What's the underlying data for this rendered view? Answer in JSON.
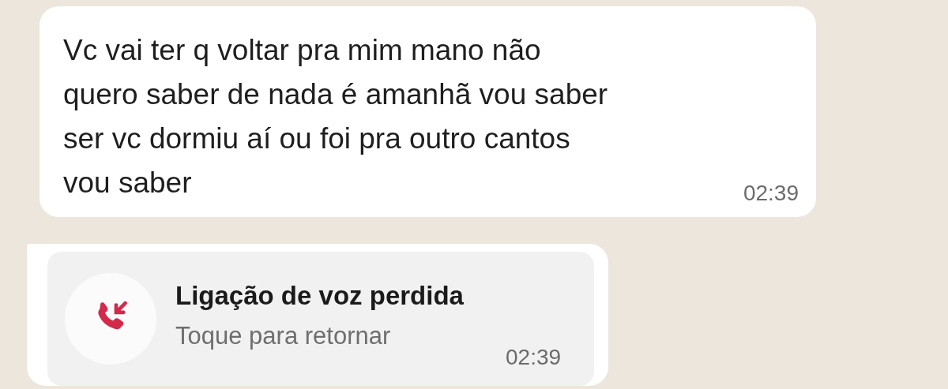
{
  "messages": [
    {
      "kind": "text",
      "text": "Vc vai ter q voltar pra mim mano não\nquero saber de nada é amanhã vou saber\nser vc dormiu aí ou foi pra outro cantos\nvou saber",
      "time": "02:39"
    },
    {
      "kind": "missed_call",
      "title": "Ligação de voz perdida",
      "subtitle": "Toque para retornar",
      "time": "02:39"
    }
  ]
}
